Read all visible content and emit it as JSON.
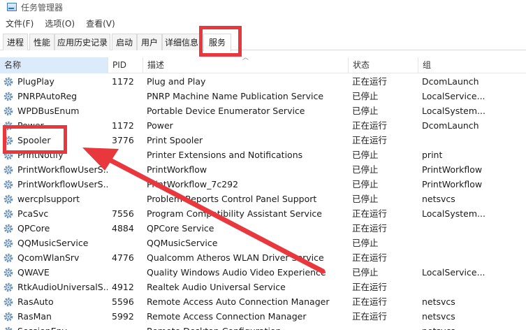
{
  "window": {
    "title": "任务管理器"
  },
  "menu": [
    "文件(F)",
    "选项(O)",
    "查看(V)"
  ],
  "tabs": [
    "进程",
    "性能",
    "应用历史记录",
    "启动",
    "用户",
    "详细信息",
    "服务"
  ],
  "active_tab": "服务",
  "columns": {
    "name": "名称",
    "pid": "PID",
    "description": "描述",
    "status": "状态",
    "group": "组"
  },
  "services": [
    {
      "name": "PlugPlay",
      "pid": "1172",
      "description": "Plug and Play",
      "status": "正在运行",
      "group": "DcomLaunch"
    },
    {
      "name": "PNRPAutoReg",
      "pid": "",
      "description": "PNRP Machine Name Publication Service",
      "status": "已停止",
      "group": "LocalService..."
    },
    {
      "name": "WPDBusEnum",
      "pid": "",
      "description": "Portable Device Enumerator Service",
      "status": "已停止",
      "group": "LocalSystem..."
    },
    {
      "name": "Power",
      "pid": "1172",
      "description": "Power",
      "status": "正在运行",
      "group": "DcomLaunch"
    },
    {
      "name": "Spooler",
      "pid": "3776",
      "description": "Print Spooler",
      "status": "正在运行",
      "group": ""
    },
    {
      "name": "PrintNotify",
      "pid": "",
      "description": "Printer Extensions and Notifications",
      "status": "已停止",
      "group": "print"
    },
    {
      "name": "PrintWorkflowUserS...",
      "pid": "",
      "description": "PrintWorkflow",
      "status": "已停止",
      "group": "PrintWorkflow"
    },
    {
      "name": "PrintWorkflowUserS...",
      "pid": "",
      "description": "PrintWorkflow_7c292",
      "status": "已停止",
      "group": "PrintWorkflow"
    },
    {
      "name": "wercplsupport",
      "pid": "",
      "description": "Problem Reports Control Panel Support",
      "status": "已停止",
      "group": "netsvcs"
    },
    {
      "name": "PcaSvc",
      "pid": "7556",
      "description": "Program Compatibility Assistant Service",
      "status": "正在运行",
      "group": "LocalSystem..."
    },
    {
      "name": "QPCore",
      "pid": "4884",
      "description": "QPCore Service",
      "status": "正在运行",
      "group": ""
    },
    {
      "name": "QQMusicService",
      "pid": "",
      "description": "QQMusicService",
      "status": "已停止",
      "group": ""
    },
    {
      "name": "QcomWlanSrv",
      "pid": "4776",
      "description": "Qualcomm Atheros WLAN Driver Service",
      "status": "正在运行",
      "group": ""
    },
    {
      "name": "QWAVE",
      "pid": "",
      "description": "Quality Windows Audio Video Experience",
      "status": "已停止",
      "group": "LocalService..."
    },
    {
      "name": "RtkAudioUniversalS...",
      "pid": "4912",
      "description": "Realtek Audio Universal Service",
      "status": "正在运行",
      "group": ""
    },
    {
      "name": "RasAuto",
      "pid": "5596",
      "description": "Remote Access Auto Connection Manager",
      "status": "正在运行",
      "group": "netsvcs"
    },
    {
      "name": "RasMan",
      "pid": "5992",
      "description": "Remote Access Connection Manager",
      "status": "正在运行",
      "group": "netsvcs"
    },
    {
      "name": "SessionEnv",
      "pid": "",
      "description": "Remote Desktop Configuration",
      "status": "",
      "group": "netsvcs"
    }
  ],
  "colors": {
    "annotation_red": "#e8383d",
    "sorted_header_bg": "#dcebfc"
  }
}
